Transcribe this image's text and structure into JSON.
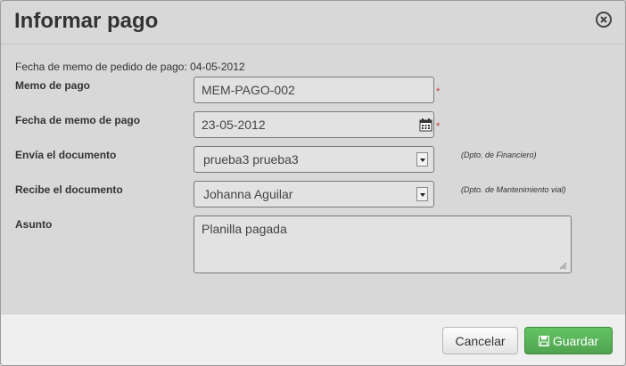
{
  "dialog": {
    "title": "Informar pago"
  },
  "info": {
    "fecha_pedido_label": "Fecha de memo de pedido de pago:",
    "fecha_pedido_value": "04-05-2012"
  },
  "fields": {
    "memo": {
      "label": "Memo de pago",
      "value": "MEM-PAGO-002",
      "required_mark": "*"
    },
    "fecha_memo": {
      "label": "Fecha de memo de pago",
      "value": "23-05-2012",
      "required_mark": "*"
    },
    "envia": {
      "label": "Envía el documento",
      "value": "prueba3 prueba3",
      "dept": "(Dpto. de Financiero)"
    },
    "recibe": {
      "label": "Recibe el documento",
      "value": "Johanna Aguilar",
      "dept": "(Dpto. de Mantenimiento vial)"
    },
    "asunto": {
      "label": "Asunto",
      "value": "Planilla pagada"
    }
  },
  "footer": {
    "cancel_label": "Cancelar",
    "save_label": "Guardar"
  },
  "icons": {
    "close": "close-circle-icon",
    "calendar": "calendar-icon",
    "save": "floppy-disk-icon",
    "dropdown": "chevron-down-icon"
  },
  "colors": {
    "save_button": "#5bb75b",
    "required": "#c0392b"
  }
}
